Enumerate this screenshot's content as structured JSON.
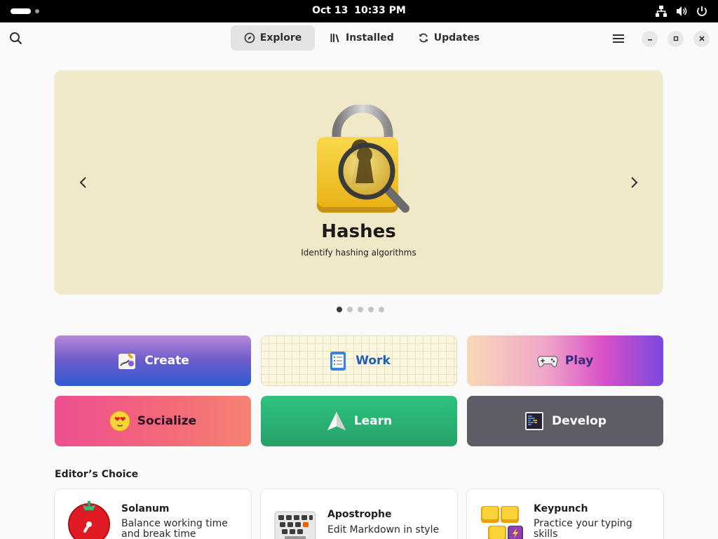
{
  "system_bar": {
    "date": "Oct 13",
    "time": "10:33 PM"
  },
  "header": {
    "tabs": [
      {
        "label": "Explore",
        "icon": "compass-icon",
        "active": true
      },
      {
        "label": "Installed",
        "icon": "library-icon",
        "active": false
      },
      {
        "label": "Updates",
        "icon": "refresh-icon",
        "active": false
      }
    ]
  },
  "featured": {
    "title": "Hashes",
    "subtitle": "Identify hashing algorithms",
    "icon": "padlock-magnifier-icon",
    "page_count": 5,
    "current_page": 1,
    "background": "#f1e8c8"
  },
  "categories": [
    {
      "label": "Create",
      "icon": "create-icon"
    },
    {
      "label": "Work",
      "icon": "checklist-icon"
    },
    {
      "label": "Play",
      "icon": "gamepad-icon"
    },
    {
      "label": "Socialize",
      "icon": "heart-eyes-emoji-icon"
    },
    {
      "label": "Learn",
      "icon": "paper-plane-icon"
    },
    {
      "label": "Develop",
      "icon": "terminal-icon"
    }
  ],
  "editors_choice": {
    "title": "Editor’s Choice",
    "apps": [
      {
        "name": "Solanum",
        "description": "Balance working time and break time",
        "icon": "tomato-timer-icon"
      },
      {
        "name": "Apostrophe",
        "description": "Edit Markdown in style",
        "icon": "keyboard-icon"
      },
      {
        "name": "Keypunch",
        "description": "Practice your typing skills",
        "icon": "keycaps-icon"
      }
    ]
  },
  "colors": {
    "accent_blue": "#1c5fb8",
    "learn_green": "#2ec27e",
    "develop_gray": "#5e5c64"
  }
}
